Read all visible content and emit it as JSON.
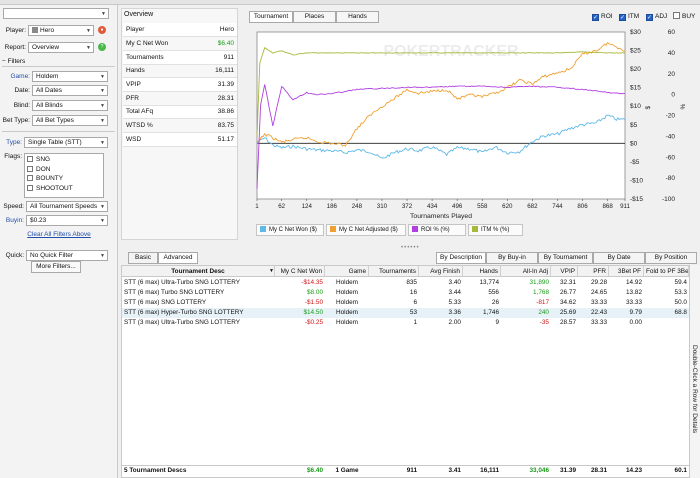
{
  "left_panel": {
    "player_label": "Player:",
    "player_value": "Hero",
    "report_label": "Report:",
    "report_value": "Overview",
    "filters_label": "Filters",
    "game_label": "Game:",
    "game_value": "Holdem",
    "date_label": "Date:",
    "date_value": "All Dates",
    "blind_label": "Blind:",
    "blind_value": "All Blinds",
    "bettype_label": "Bet Type:",
    "bettype_value": "All Bet Types",
    "type_label": "Type:",
    "type_value": "Single Table (STT)",
    "flags_label": "Flags:",
    "flags": [
      "SNG",
      "DON",
      "BOUNTY",
      "SHOOTOUT"
    ],
    "speed_label": "Speed:",
    "speed_value": "All Tournament Speeds",
    "buyin_label": "Buyin:",
    "buyin_value": "$0.23",
    "clear_label": "Clear All Filters Above",
    "quick_label": "Quick:",
    "quick_value": "No Quick Filter",
    "more_filters_label": "More Filters..."
  },
  "overview": {
    "title": "Overview",
    "rows": [
      {
        "label": "Player",
        "value": "Hero",
        "color": "#111111"
      },
      {
        "label": "My C Net Won",
        "value": "$6.40",
        "color": "#1a9a1a"
      },
      {
        "label": "Tournaments",
        "value": "911",
        "color": "#111111"
      },
      {
        "label": "Hands",
        "value": "16,111",
        "color": "#111111"
      },
      {
        "label": "VPIP",
        "value": "31.39",
        "color": "#111111"
      },
      {
        "label": "PFR",
        "value": "28.31",
        "color": "#111111"
      },
      {
        "label": "Total AFq",
        "value": "38.86",
        "color": "#111111"
      },
      {
        "label": "WTSD %",
        "value": "83.75",
        "color": "#111111"
      },
      {
        "label": "WSD",
        "value": "51.17",
        "color": "#111111"
      }
    ]
  },
  "graph": {
    "tabs": [
      "Tournament",
      "Places",
      "Hands"
    ],
    "toggles": [
      {
        "label": "ROI",
        "checked": true
      },
      {
        "label": "ITM",
        "checked": true
      },
      {
        "label": "ADJ",
        "checked": true
      },
      {
        "label": "BUY",
        "checked": false
      }
    ],
    "watermark": "POKERTRACKER",
    "legend": [
      {
        "label": "My C Net Won ($)",
        "color": "#5fb8e6"
      },
      {
        "label": "My C Net Adjusted ($)",
        "color": "#f0a030"
      },
      {
        "label": "ROI % (%)",
        "color": "#b040e0"
      },
      {
        "label": "ITM % (%)",
        "color": "#a8b83a"
      }
    ]
  },
  "chart_data": {
    "type": "line",
    "xlabel": "Tournaments Played",
    "x_ticks": [
      1,
      62,
      124,
      186,
      248,
      310,
      372,
      434,
      496,
      558,
      620,
      682,
      744,
      806,
      868,
      911
    ],
    "xlim": [
      1,
      911
    ],
    "y_left_ticks": [
      "$30",
      "$25",
      "$20",
      "$15",
      "$10",
      "$5",
      "$0",
      "-$5",
      "-$10",
      "-$15"
    ],
    "ylim_left": [
      -15,
      30
    ],
    "y_left_unit": "$",
    "y_right_ticks": [
      "60",
      "40",
      "20",
      "0",
      "-20",
      "-40",
      "-60",
      "-80",
      "-100"
    ],
    "ylim_right": [
      -100,
      60
    ],
    "y_right_unit": "%",
    "series": [
      {
        "name": "My C Net Won ($)",
        "axis": "left",
        "x": [
          1,
          20,
          40,
          62,
          90,
          124,
          150,
          186,
          220,
          248,
          280,
          310,
          340,
          372,
          400,
          434,
          470,
          496,
          530,
          558,
          590,
          620,
          650,
          682,
          710,
          744,
          775,
          806,
          840,
          868,
          890,
          911
        ],
        "y": [
          0,
          1.5,
          -0.5,
          -1.2,
          -0.8,
          -1.5,
          -1.8,
          -2,
          -2.5,
          -1.8,
          -2.2,
          -4.2,
          -2.5,
          -1.5,
          -2,
          -1,
          -3,
          -1.2,
          -1.5,
          -2.5,
          -1,
          -2.5,
          -2.2,
          0.5,
          2,
          2.5,
          4,
          5,
          5.5,
          7.5,
          6.5,
          6.4
        ]
      },
      {
        "name": "My C Net Adjusted ($)",
        "axis": "left",
        "x": [
          1,
          20,
          40,
          62,
          90,
          124,
          150,
          186,
          220,
          248,
          280,
          310,
          340,
          372,
          400,
          434,
          470,
          496,
          530,
          558,
          590,
          620,
          650,
          682,
          710,
          744,
          775,
          806,
          840,
          868,
          890,
          911
        ],
        "y": [
          0,
          2.5,
          1.5,
          0.3,
          1,
          1.5,
          0.5,
          0,
          -0.5,
          4,
          7.5,
          10,
          12,
          14.5,
          13.5,
          14,
          14.5,
          12,
          13,
          12.5,
          13.5,
          15,
          17,
          16,
          18,
          19,
          20,
          24,
          25,
          27,
          26,
          25
        ]
      },
      {
        "name": "ROI % (%)",
        "axis": "right",
        "x": [
          1,
          10,
          20,
          40,
          62,
          90,
          124,
          150,
          186,
          220,
          248,
          310,
          372,
          434,
          496,
          558,
          620,
          682,
          744,
          806,
          868,
          911
        ],
        "y": [
          -90,
          -10,
          10,
          -30,
          8,
          -5,
          2,
          0,
          1,
          3,
          5,
          6,
          7,
          7,
          8,
          8,
          7,
          8,
          7,
          5,
          2,
          1
        ]
      },
      {
        "name": "ITM % (%)",
        "axis": "right",
        "x": [
          1,
          8,
          20,
          40,
          62,
          90,
          124,
          186,
          248,
          310,
          372,
          434,
          496,
          558,
          620,
          682,
          744,
          806,
          868,
          911
        ],
        "y": [
          -40,
          30,
          45,
          40,
          42,
          38,
          40,
          40,
          40,
          40,
          40,
          40,
          40,
          40,
          40,
          40,
          40,
          41,
          40,
          40
        ]
      }
    ]
  },
  "lower": {
    "tabs": [
      "Basic",
      "Advanced"
    ],
    "sort_buttons": [
      "By Description",
      "By Buy-in",
      "By Tournament",
      "By Date",
      "By Position"
    ],
    "columns": [
      "Tournament Desc",
      "My C Net Won",
      "Game",
      "Tournaments",
      "Avg Finish",
      "Hands",
      "All-In Adj",
      "VPIP",
      "PFR",
      "3Bet PF",
      "Fold to PF 3Be"
    ],
    "rows": [
      {
        "desc": "STT (6 max) Ultra-Turbo SNG LOTTERY",
        "won": "-$14.35",
        "won_cls": "neg",
        "game": "Holdem",
        "tourn": "835",
        "avg": "3.40",
        "hands": "13,774",
        "allin": "31,890",
        "allin_cls": "pos",
        "vpip": "32.31",
        "pfr": "29.28",
        "bet3": "14.92",
        "fold3": "59.4"
      },
      {
        "desc": "STT (6 max) Turbo SNG LOTTERY",
        "won": "$8.00",
        "won_cls": "pos",
        "game": "Holdem",
        "tourn": "16",
        "avg": "3.44",
        "hands": "556",
        "allin": "1,768",
        "allin_cls": "pos",
        "vpip": "26.77",
        "pfr": "24.65",
        "bet3": "13.82",
        "fold3": "53.3"
      },
      {
        "desc": "STT (6 max) SNG LOTTERY",
        "won": "-$1.50",
        "won_cls": "neg",
        "game": "Holdem",
        "tourn": "6",
        "avg": "5.33",
        "hands": "26",
        "allin": "-817",
        "allin_cls": "neg",
        "vpip": "34.62",
        "pfr": "33.33",
        "bet3": "33.33",
        "fold3": "50.0"
      },
      {
        "desc": "STT (6 max) Hyper-Turbo SNG LOTTERY",
        "won": "$14.50",
        "won_cls": "pos",
        "game": "Holdem",
        "tourn": "53",
        "avg": "3.36",
        "hands": "1,746",
        "allin": "240",
        "allin_cls": "pos",
        "vpip": "25.69",
        "pfr": "22.43",
        "bet3": "9.79",
        "fold3": "68.8"
      },
      {
        "desc": "STT (3 max) Ultra-Turbo SNG LOTTERY",
        "won": "-$0.25",
        "won_cls": "neg",
        "game": "Holdem",
        "tourn": "1",
        "avg": "2.00",
        "hands": "9",
        "allin": "-35",
        "allin_cls": "neg",
        "vpip": "28.57",
        "pfr": "33.33",
        "bet3": "0.00",
        "fold3": ""
      }
    ],
    "total": {
      "desc": "5 Tournament Descs",
      "won": "$6.40",
      "game": "1 Game",
      "tourn": "911",
      "avg": "3.41",
      "hands": "16,111",
      "allin": "33,046",
      "vpip": "31.39",
      "pfr": "28.31",
      "bet3": "14.23",
      "fold3": "60.1"
    },
    "side_hint": "Double-Click a Row for Details"
  }
}
